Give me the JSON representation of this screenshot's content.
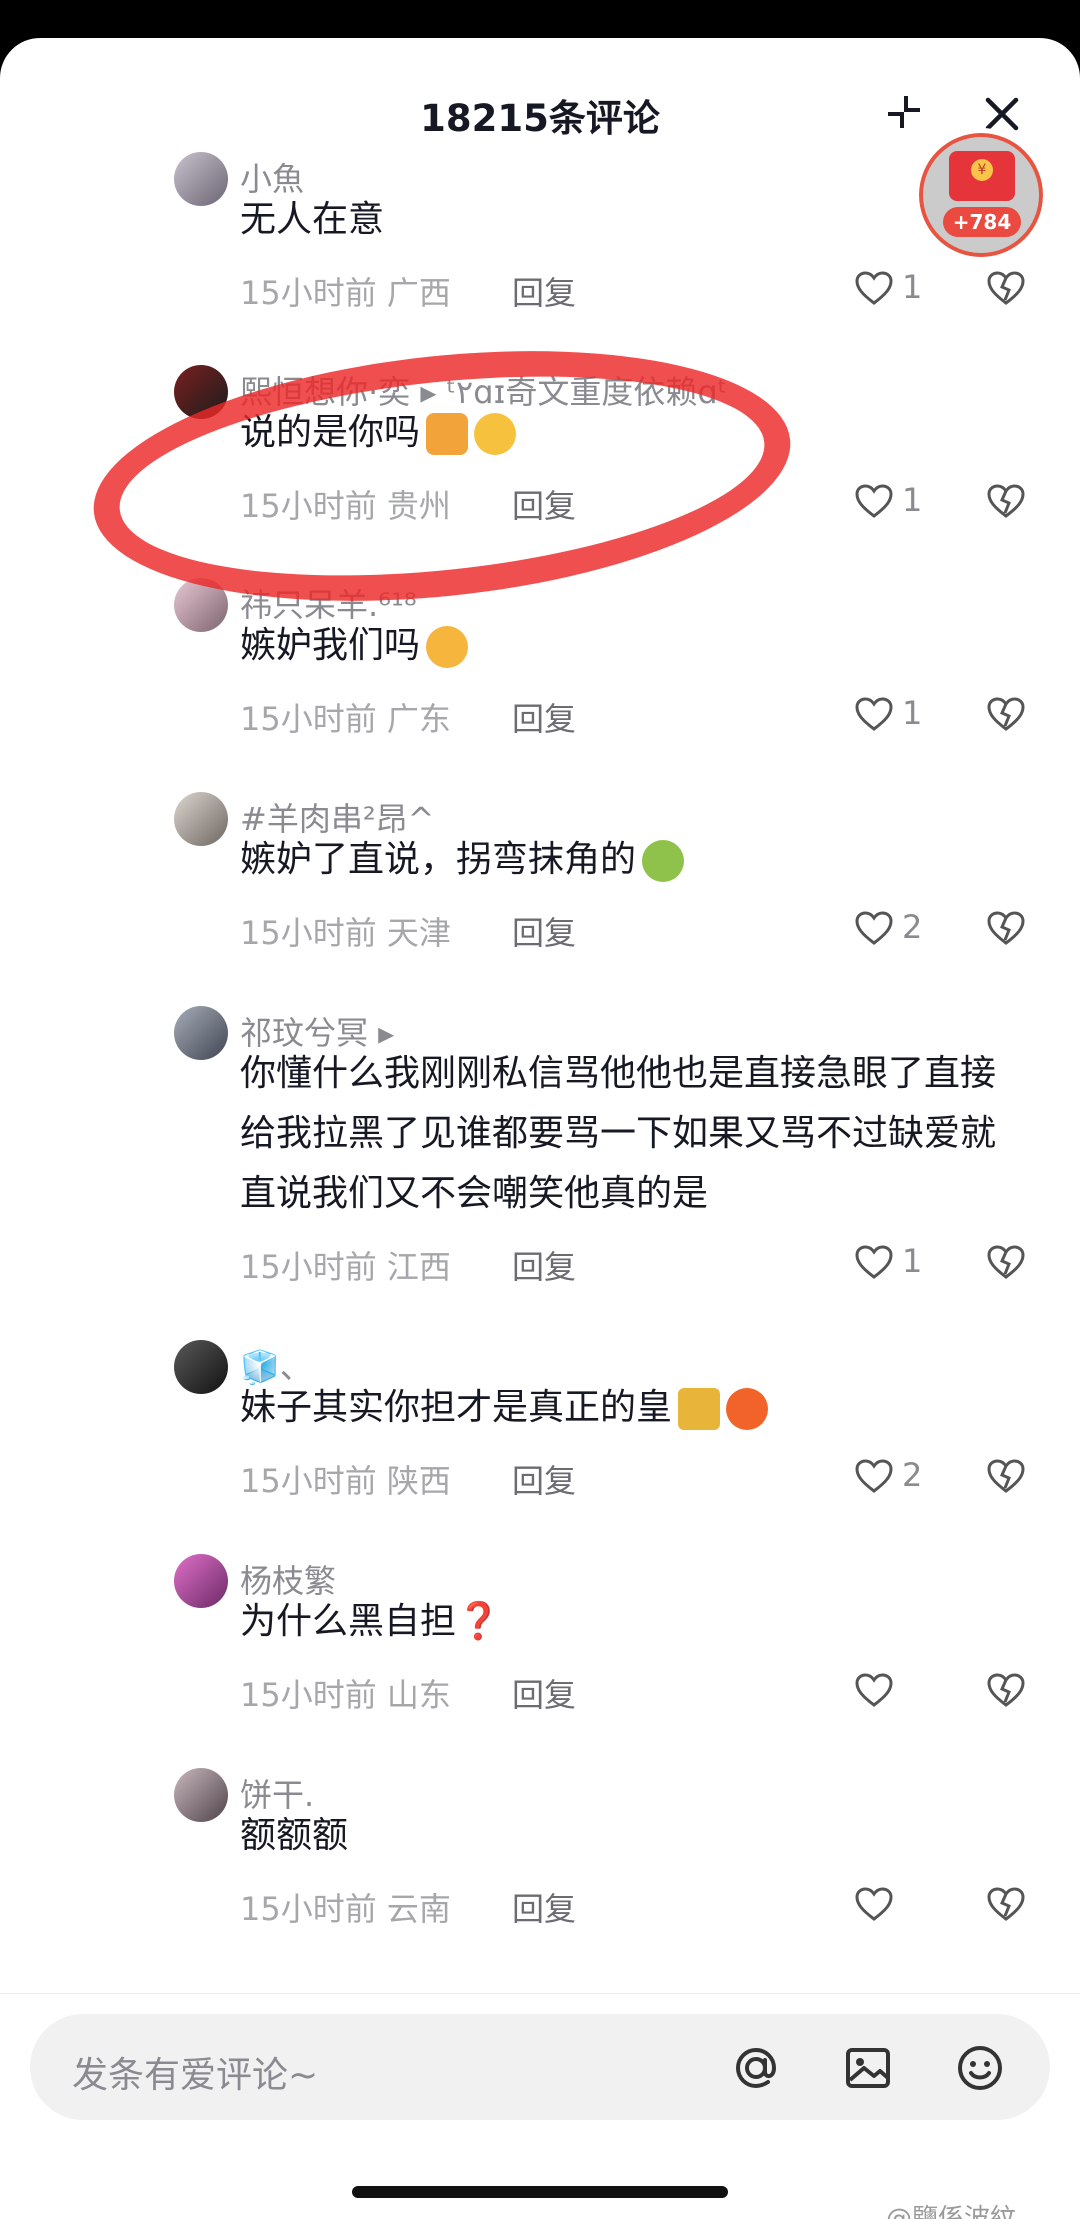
{
  "header": {
    "title": "18215条评论"
  },
  "red_packet": {
    "bonus": "+784"
  },
  "comments": [
    {
      "username": "小魚",
      "content": "无人在意",
      "time": "15小时前",
      "location": "广西",
      "reply": "回复",
      "likes": "1"
    },
    {
      "username": "熙恒想你·奕 ▸ ᵗ٢ɑɪ奇文重度依赖ɑᵗ",
      "content": "说的是你吗",
      "time": "15小时前",
      "location": "贵州",
      "reply": "回复",
      "likes": "1"
    },
    {
      "username": "祎只呆羊.⁶¹⁸",
      "content": "嫉妒我们吗",
      "time": "15小时前",
      "location": "广东",
      "reply": "回复",
      "likes": "1"
    },
    {
      "username": "#羊肉串²昂^",
      "content": "嫉妒了直说，拐弯抹角的",
      "time": "15小时前",
      "location": "天津",
      "reply": "回复",
      "likes": "2"
    },
    {
      "username": "祁玟兮冥 ▸",
      "content": "你懂什么我刚刚私信骂他他也是直接急眼了直接给我拉黑了见谁都要骂一下如果又骂不过缺爱就直说我们又不会嘲笑他真的是",
      "time": "15小时前",
      "location": "江西",
      "reply": "回复",
      "likes": "1"
    },
    {
      "username": "🧊、",
      "content": "妹子其实你担才是真正的皇",
      "time": "15小时前",
      "location": "陕西",
      "reply": "回复",
      "likes": "2"
    },
    {
      "username": "杨枝繁",
      "content": "为什么黑自担❓",
      "time": "15小时前",
      "location": "山东",
      "reply": "回复",
      "likes": ""
    },
    {
      "username": "饼干.",
      "content": "额额额",
      "time": "15小时前",
      "location": "云南",
      "reply": "回复",
      "likes": ""
    }
  ],
  "input": {
    "placeholder": "发条有爱评论~"
  },
  "watermark": "@鹽係波紋",
  "colors": {
    "circle": "#ec2828",
    "accent": "#e6343b"
  },
  "icons": [
    "collapse-icon",
    "close-icon",
    "heart-icon",
    "broken-heart-icon",
    "at-icon",
    "image-icon",
    "emoji-icon"
  ]
}
